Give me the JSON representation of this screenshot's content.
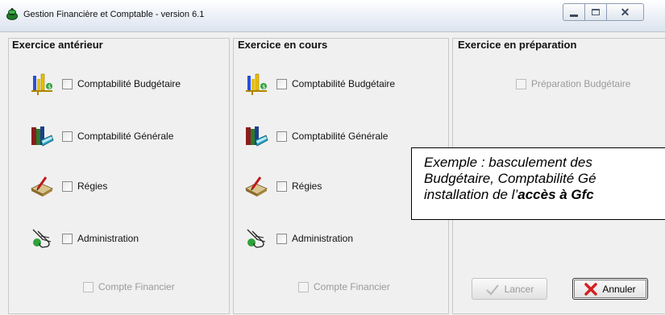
{
  "window": {
    "title": "Gestion Financière et Comptable - version 6.1",
    "controls": {
      "minimize_icon": "minimize-icon",
      "maximize_icon": "maximize-icon",
      "close_icon": "close-icon"
    }
  },
  "panels": {
    "previous": {
      "title": "Exercice antérieur",
      "items": [
        {
          "label": "Comptabilité Budgétaire",
          "icon": "budget-chart-icon",
          "checked": false,
          "enabled": true
        },
        {
          "label": "Comptabilité Générale",
          "icon": "books-icon",
          "checked": false,
          "enabled": true
        },
        {
          "label": "Régies",
          "icon": "ledger-pen-icon",
          "checked": false,
          "enabled": true
        },
        {
          "label": "Administration",
          "icon": "hand-pointer-icon",
          "checked": false,
          "enabled": true
        },
        {
          "label": "Compte Financier",
          "checked": false,
          "enabled": false
        }
      ]
    },
    "current": {
      "title": "Exercice en cours",
      "items": [
        {
          "label": "Comptabilité Budgétaire",
          "icon": "budget-chart-icon",
          "checked": false,
          "enabled": true
        },
        {
          "label": "Comptabilité Générale",
          "icon": "books-icon",
          "checked": false,
          "enabled": true
        },
        {
          "label": "Régies",
          "icon": "ledger-pen-icon",
          "checked": false,
          "enabled": true
        },
        {
          "label": "Administration",
          "icon": "hand-pointer-icon",
          "checked": false,
          "enabled": true
        },
        {
          "label": "Compte Financier",
          "checked": false,
          "enabled": false
        }
      ]
    },
    "preparation": {
      "title": "Exercice en préparation",
      "items": [
        {
          "label": "Préparation Budgétaire",
          "checked": false,
          "enabled": false
        }
      ]
    }
  },
  "buttons": {
    "launch": {
      "label": "Lancer",
      "icon": "checkmark-icon",
      "enabled": false
    },
    "cancel": {
      "label": "Annuler",
      "icon": "red-x-icon",
      "enabled": true
    }
  },
  "callout": {
    "line1": "Exemple : basculement des",
    "line2": "Budgétaire, Comptabilité Gé",
    "line3_prefix": "installation de l’",
    "line3_bold": "accès à Gfc"
  },
  "colors": {
    "window_bg": "#f0f0f0",
    "disabled_text": "#9a9a9a",
    "cancel_icon": "#d42020"
  }
}
